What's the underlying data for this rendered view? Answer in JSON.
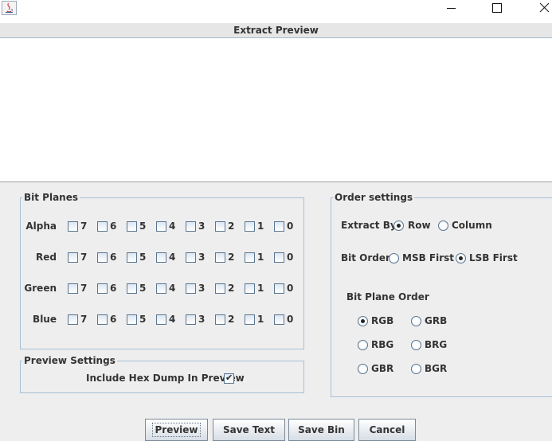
{
  "window": {
    "title": "Extract Preview",
    "controls": [
      "minimize-icon",
      "maximize-icon",
      "close-icon"
    ]
  },
  "bit_planes": {
    "title": "Bit Planes",
    "bits": [
      "7",
      "6",
      "5",
      "4",
      "3",
      "2",
      "1",
      "0"
    ],
    "rows": [
      {
        "label": "Alpha"
      },
      {
        "label": "Red"
      },
      {
        "label": "Green"
      },
      {
        "label": "Blue"
      }
    ]
  },
  "preview_settings": {
    "title": "Preview Settings",
    "hex_dump_label": "Include Hex Dump In Preview",
    "hex_dump_checked": true
  },
  "order_settings": {
    "title": "Order settings",
    "extract_by_label": "Extract By",
    "extract_by_options": [
      "Row",
      "Column"
    ],
    "extract_by_selected": "Row",
    "bit_order_label": "Bit Order",
    "bit_order_options": [
      "MSB First",
      "LSB First"
    ],
    "bit_order_selected": "LSB First",
    "bit_plane_order_label": "Bit Plane Order",
    "bit_plane_order_options": [
      "RGB",
      "GRB",
      "RBG",
      "BRG",
      "GBR",
      "BGR"
    ],
    "bit_plane_order_selected": "RGB"
  },
  "buttons": {
    "preview": "Preview",
    "save_text": "Save Text",
    "save_bin": "Save Bin",
    "cancel": "Cancel"
  }
}
